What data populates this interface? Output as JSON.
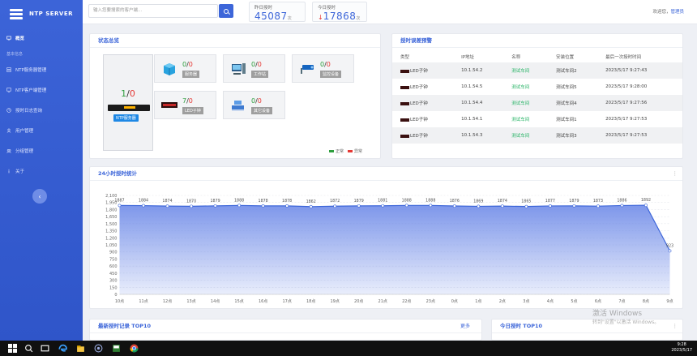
{
  "brand": {
    "title": "NTP SERVER"
  },
  "sidebar": {
    "items": [
      {
        "label": "概览",
        "icon": "monitor-icon",
        "active": true
      },
      {
        "label": "NTP服务器管理",
        "icon": "server-icon"
      },
      {
        "label": "NTP客户端管理",
        "icon": "client-icon"
      },
      {
        "label": "授时日志查询",
        "icon": "log-icon"
      },
      {
        "label": "用户管理",
        "icon": "user-icon"
      },
      {
        "label": "分组管理",
        "icon": "group-icon"
      },
      {
        "label": "关于",
        "icon": "info-icon"
      }
    ],
    "section_label": "基本信息"
  },
  "topbar": {
    "search_placeholder": "输入您要搜索的客户端...",
    "yesterday": {
      "label": "昨日授时",
      "value": "45087",
      "unit": "次"
    },
    "today": {
      "label": "今日授时",
      "value": "17868",
      "unit": "次"
    },
    "welcome": "欢迎您，",
    "user": "管理员"
  },
  "status": {
    "title": "状态总览",
    "ntp": {
      "ok": "1",
      "err": "0",
      "label": "NTP服务器"
    },
    "devices": [
      {
        "ok": "0",
        "err": "0",
        "label": "服务器",
        "icon": "server-cube-icon"
      },
      {
        "ok": "0",
        "err": "0",
        "label": "工作站",
        "icon": "workstation-icon"
      },
      {
        "ok": "0",
        "err": "0",
        "label": "监控设备",
        "icon": "camera-icon"
      },
      {
        "ok": "7",
        "err": "0",
        "label": "LED子钟",
        "icon": "led-clock-icon"
      },
      {
        "ok": "0",
        "err": "0",
        "label": "其它设备",
        "icon": "other-device-icon"
      }
    ],
    "legend_ok": "正常",
    "legend_err": "异常",
    "colors": {
      "ok": "#2e9e3e",
      "err": "#e53935"
    }
  },
  "alerts": {
    "title": "授时误差预警",
    "columns": [
      "类型",
      "IP地址",
      "名称",
      "安装位置",
      "最后一次授时时间"
    ],
    "rows": [
      {
        "type": "LED子钟",
        "ip": "10.1.54.2",
        "name": "测试车间",
        "place": "测试车间2",
        "time": "2023/5/17 9:27:43"
      },
      {
        "type": "LED子钟",
        "ip": "10.1.54.5",
        "name": "测试车间",
        "place": "测试车间5",
        "time": "2023/5/17 9:28:00"
      },
      {
        "type": "LED子钟",
        "ip": "10.1.54.4",
        "name": "测试车间",
        "place": "测试车间4",
        "time": "2023/5/17 9:27:56"
      },
      {
        "type": "LED子钟",
        "ip": "10.1.54.1",
        "name": "测试车间",
        "place": "测试车间1",
        "time": "2023/5/17 9:27:53"
      },
      {
        "type": "LED子钟",
        "ip": "10.1.54.3",
        "name": "测试车间",
        "place": "测试车间3",
        "time": "2023/5/17 9:27:53"
      }
    ]
  },
  "chart_data": {
    "type": "area",
    "title": "24小时授时统计",
    "categories": [
      "10点",
      "11点",
      "12点",
      "13点",
      "14点",
      "15点",
      "16点",
      "17点",
      "18点",
      "19点",
      "20点",
      "21点",
      "22点",
      "23点",
      "0点",
      "1点",
      "2点",
      "3点",
      "4点",
      "5点",
      "6点",
      "7点",
      "8点",
      "9点"
    ],
    "values": [
      1887,
      1884,
      1874,
      1870,
      1879,
      1888,
      1878,
      1878,
      1862,
      1872,
      1879,
      1881,
      1888,
      1888,
      1876,
      1869,
      1874,
      1865,
      1877,
      1879,
      1873,
      1886,
      1892,
      923
    ],
    "ylim": [
      0,
      2100
    ],
    "yticks": [
      "0",
      "150",
      "300",
      "450",
      "600",
      "750",
      "900",
      "1,050",
      "1,200",
      "1,350",
      "1,500",
      "1,650",
      "1,800",
      "1,950",
      "2,100"
    ],
    "grid": true,
    "colors": {
      "line": "#3d66d9",
      "fill": "#6f8be8"
    }
  },
  "bottom": {
    "recent_title": "最新授时记录 TOP10",
    "recent_more": "更多",
    "today_title": "今日授时 TOP10"
  },
  "watermark": {
    "line1": "激活 Windows",
    "line2": "转到\"设置\"以激活 Windows。"
  },
  "taskbar": {
    "time": "9:28",
    "date": "2023/5/17"
  }
}
